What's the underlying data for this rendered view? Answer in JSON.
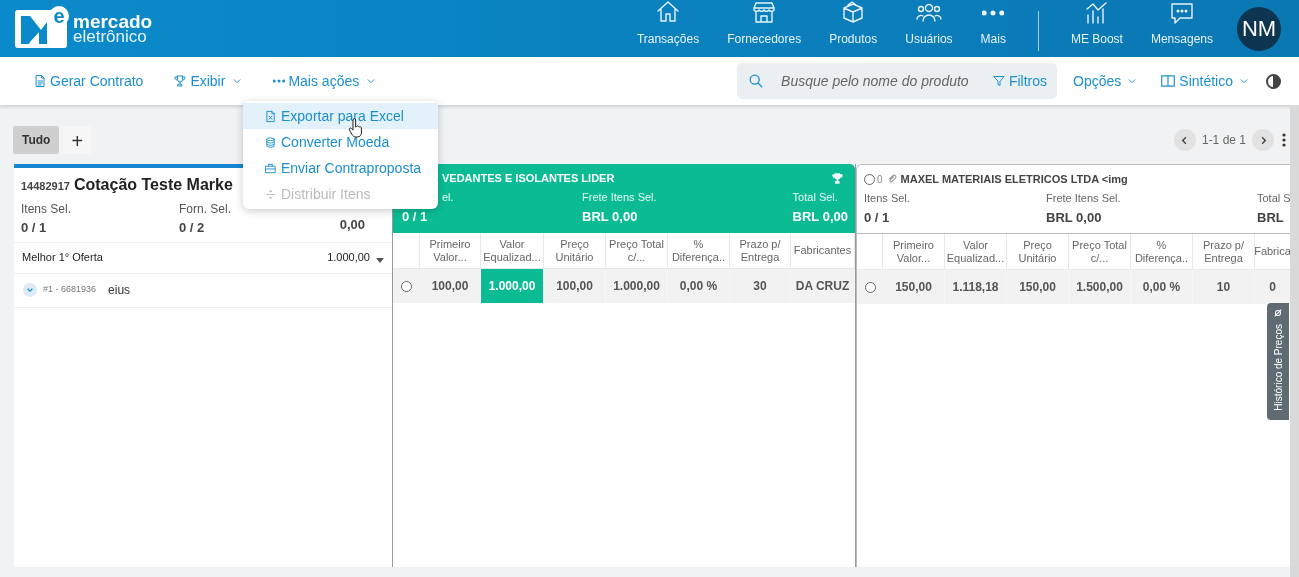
{
  "header": {
    "logo": {
      "mark": "e",
      "word1": "mercado",
      "word2": "eletrônico"
    },
    "nav": [
      {
        "kind": "home",
        "label": "Transações"
      },
      {
        "kind": "store",
        "label": "Fornecedores"
      },
      {
        "kind": "box",
        "label": "Produtos"
      },
      {
        "kind": "users",
        "label": "Usuários"
      },
      {
        "kind": "dots",
        "label": "Mais"
      },
      {
        "kind": "chart",
        "label": "ME Boost"
      },
      {
        "kind": "chat",
        "label": "Mensagens"
      }
    ],
    "avatar": "NM"
  },
  "toolbar": {
    "actions": [
      {
        "kind": "doc",
        "label": "Gerar Contrato",
        "caret": false
      },
      {
        "kind": "trophy",
        "label": "Exibir",
        "caret": true
      },
      {
        "kind": "dots",
        "label": "Mais ações",
        "caret": true
      }
    ],
    "search": {
      "placeholder": "Busque pelo nome do produto"
    },
    "filter": "Filtros",
    "options": [
      {
        "kind": "none",
        "label": "Opções"
      },
      {
        "kind": "columns",
        "label": "Sintético"
      }
    ]
  },
  "menu": {
    "items": [
      {
        "kind": "excel",
        "label": "Exportar para Excel",
        "highlighted": true,
        "disabled": false
      },
      {
        "kind": "coins",
        "label": "Converter Moeda",
        "highlighted": false,
        "disabled": false
      },
      {
        "kind": "briefcase",
        "label": "Enviar Contraproposta",
        "highlighted": false,
        "disabled": false
      },
      {
        "kind": "divide",
        "label": "Distribuir Itens",
        "highlighted": false,
        "disabled": true
      }
    ]
  },
  "tabs": [
    {
      "label": "Tudo",
      "selected": true
    }
  ],
  "add_tab": "+",
  "pager": "1-1 de 1",
  "summary": {
    "code": "14482917",
    "title": "Cotação Teste Marke",
    "stats": [
      {
        "label": "Itens Sel.",
        "value": "0 / 1"
      },
      {
        "label": "Forn. Sel.",
        "value": "0 / 2"
      },
      {
        "value": "0,00"
      }
    ],
    "best_offer": {
      "label": "Melhor 1° Oferta",
      "value": "1.000,00"
    },
    "item": {
      "number": "#1 - 6681936",
      "name": "eius"
    }
  },
  "suppliers": [
    {
      "name": "VEDANTES E ISOLANTES LIDER",
      "winner": true,
      "stats": [
        {
          "label": "el.",
          "value": "0 / 1"
        },
        {
          "label": "Frete Itens Sel.",
          "value": "BRL 0,00"
        },
        {
          "label": "Total Sel.",
          "value": "BRL 0,00"
        }
      ],
      "columns": [
        "Primeiro Valor...",
        "Valor Equalizad...",
        "Preço Unitário",
        "Preço Total c/...",
        "% Diferença..",
        "Prazo p/ Entrega",
        "Fabricantes"
      ],
      "row": {
        "selected": false,
        "cells": [
          {
            "text": "100,00",
            "best": false
          },
          {
            "text": "1.000,00",
            "best": true
          },
          {
            "text": "100,00",
            "best": false
          },
          {
            "text": "1.000,00",
            "best": false
          },
          {
            "text": "0,00 %",
            "best": false
          },
          {
            "text": "30",
            "best": false
          },
          {
            "text": "DA CRUZ",
            "best": false
          }
        ]
      }
    },
    {
      "name": "MAXEL MATERIAIS ELETRICOS LTDA <img",
      "prefix": "0",
      "winner": false,
      "stats": [
        {
          "label": "Itens Sel.",
          "value": "0 / 1"
        },
        {
          "label": "Frete Itens Sel.",
          "value": "BRL 0,00"
        },
        {
          "label": "Total S",
          "value": "BRL"
        }
      ],
      "columns": [
        "Primeiro Valor...",
        "Valor Equalizad...",
        "Preço Unitário",
        "Preço Total c/...",
        "% Diferença..",
        "Prazo p/ Entrega",
        "Fabrica"
      ],
      "row": {
        "selected": false,
        "cells": [
          {
            "text": "150,00",
            "best": false
          },
          {
            "text": "1.118,18",
            "best": false
          },
          {
            "text": "150,00",
            "best": false
          },
          {
            "text": "1.500,00",
            "best": false
          },
          {
            "text": "0,00 %",
            "best": false
          },
          {
            "text": "10",
            "best": false
          },
          {
            "text": "0",
            "best": false
          }
        ]
      }
    }
  ],
  "side_tab": "Histórico de Preços"
}
